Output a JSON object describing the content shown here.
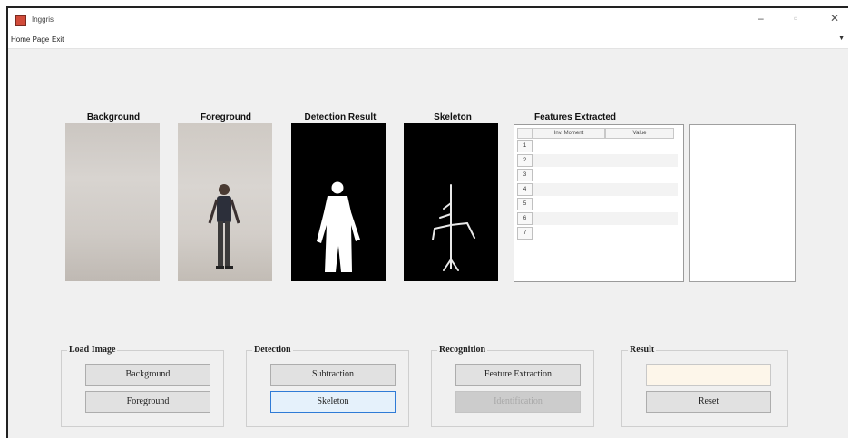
{
  "window": {
    "title": "Inggris"
  },
  "menu": {
    "items": [
      "Home Page",
      "Exit"
    ]
  },
  "images": {
    "background_label": "Background",
    "foreground_label": "Foreground",
    "detection_label": "Detection Result",
    "skeleton_label": "Skeleton"
  },
  "features": {
    "title": "Features Extracted",
    "columns": [
      "Inv. Moment",
      "Value"
    ],
    "rows": [
      "1",
      "2",
      "3",
      "4",
      "5",
      "6",
      "7"
    ]
  },
  "groups": {
    "load": {
      "label": "Load Image",
      "buttons": [
        "Background",
        "Foreground"
      ]
    },
    "detection": {
      "label": "Detection",
      "buttons": [
        "Subtraction",
        "Skeleton"
      ]
    },
    "recognition": {
      "label": "Recognition",
      "buttons": [
        "Feature Extraction",
        "Identification"
      ]
    },
    "result": {
      "label": "Result",
      "value": "",
      "reset": "Reset"
    }
  }
}
